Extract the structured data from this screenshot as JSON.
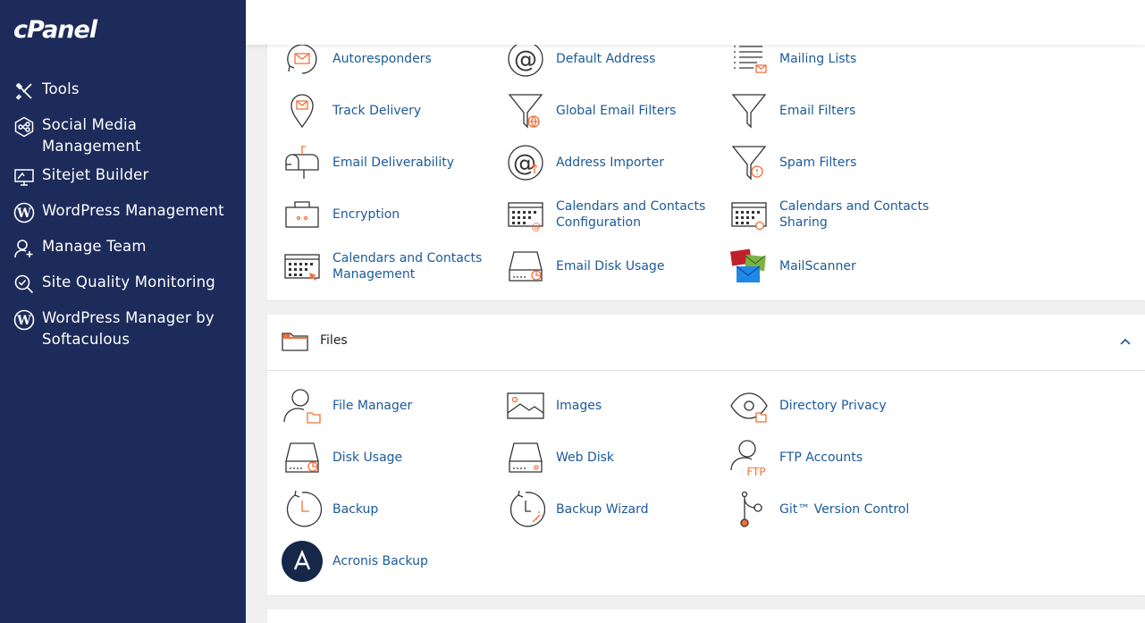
{
  "app": {
    "logo": "cPanel"
  },
  "sidebar": {
    "items": [
      {
        "label": "Tools",
        "icon": "tools-icon"
      },
      {
        "label": "Social Media Management",
        "icon": "social-media-icon"
      },
      {
        "label": "Sitejet Builder",
        "icon": "sitejet-icon"
      },
      {
        "label": "WordPress Management",
        "icon": "wordpress-icon"
      },
      {
        "label": "Manage Team",
        "icon": "manage-team-icon"
      },
      {
        "label": "Site Quality Monitoring",
        "icon": "site-quality-icon"
      },
      {
        "label": "WordPress Manager by Softaculous",
        "icon": "wordpress-softaculous-icon"
      }
    ]
  },
  "email": {
    "items": [
      {
        "label": "Autoresponders",
        "icon": "autoresponders-icon"
      },
      {
        "label": "Default Address",
        "icon": "default-address-icon"
      },
      {
        "label": "Mailing Lists",
        "icon": "mailing-lists-icon"
      },
      {
        "label": "Track Delivery",
        "icon": "track-delivery-icon"
      },
      {
        "label": "Global Email Filters",
        "icon": "global-email-filters-icon"
      },
      {
        "label": "Email Filters",
        "icon": "email-filters-icon"
      },
      {
        "label": "Email Deliverability",
        "icon": "email-deliverability-icon"
      },
      {
        "label": "Address Importer",
        "icon": "address-importer-icon"
      },
      {
        "label": "Spam Filters",
        "icon": "spam-filters-icon"
      },
      {
        "label": "Encryption",
        "icon": "encryption-icon"
      },
      {
        "label": "Calendars and Contacts Configuration",
        "icon": "calendars-configuration-icon"
      },
      {
        "label": "Calendars and Contacts Sharing",
        "icon": "calendars-sharing-icon"
      },
      {
        "label": "Calendars and Contacts Management",
        "icon": "calendars-management-icon"
      },
      {
        "label": "Email Disk Usage",
        "icon": "email-disk-usage-icon"
      },
      {
        "label": "MailScanner",
        "icon": "mailscanner-icon"
      }
    ]
  },
  "files": {
    "title": "Files",
    "items": [
      {
        "label": "File Manager",
        "icon": "file-manager-icon"
      },
      {
        "label": "Images",
        "icon": "images-icon"
      },
      {
        "label": "Directory Privacy",
        "icon": "directory-privacy-icon"
      },
      {
        "label": "Disk Usage",
        "icon": "disk-usage-icon"
      },
      {
        "label": "Web Disk",
        "icon": "web-disk-icon"
      },
      {
        "label": "FTP Accounts",
        "icon": "ftp-accounts-icon"
      },
      {
        "label": "Backup",
        "icon": "backup-icon"
      },
      {
        "label": "Backup Wizard",
        "icon": "backup-wizard-icon"
      },
      {
        "label": "Git™ Version Control",
        "icon": "git-icon"
      },
      {
        "label": "Acronis Backup",
        "icon": "acronis-icon"
      }
    ]
  },
  "colors": {
    "sidebar": "#1c2b5a",
    "link": "#1b5a99",
    "accent": "#f26f3b"
  }
}
